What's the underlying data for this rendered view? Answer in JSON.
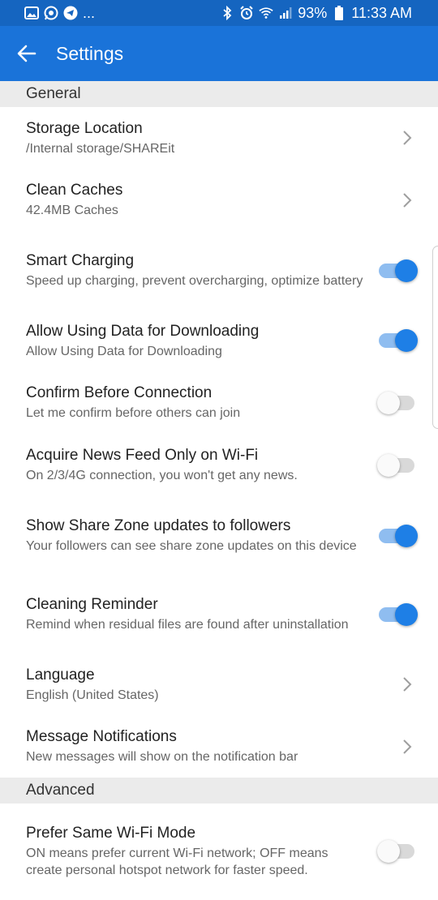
{
  "status_bar": {
    "left_icons": [
      "gallery-icon",
      "whatsapp-icon",
      "telegram-icon"
    ],
    "more": "...",
    "right_icons": [
      "bluetooth-icon",
      "alarm-icon",
      "wifi-icon",
      "signal-icon"
    ],
    "battery": "93%",
    "time": "11:33 AM"
  },
  "app_bar": {
    "title": "Settings",
    "back_icon": "arrow-left-icon",
    "background": "#1a73d9"
  },
  "sections": {
    "general": "General",
    "advanced": "Advanced"
  },
  "rows": [
    {
      "title": "Storage Location",
      "subtitle": "/Internal storage/SHAREit",
      "control": "chevron"
    },
    {
      "title": "Clean Caches",
      "subtitle": "42.4MB Caches",
      "control": "chevron"
    },
    {
      "title": "Smart Charging",
      "subtitle": "Speed up charging, prevent overcharging, optimize battery",
      "control": "toggle",
      "on": true
    },
    {
      "title": "Allow Using Data for Downloading",
      "subtitle": "Allow Using Data for Downloading",
      "control": "toggle",
      "on": true
    },
    {
      "title": "Confirm Before Connection",
      "subtitle": "Let me confirm before others can join",
      "control": "toggle",
      "on": false
    },
    {
      "title": "Acquire News Feed Only on Wi-Fi",
      "subtitle": "On 2/3/4G connection, you won't get any news.",
      "control": "toggle",
      "on": false
    },
    {
      "title": "Show Share Zone updates to followers",
      "subtitle": "Your followers can see share zone updates on this device",
      "control": "toggle",
      "on": true
    },
    {
      "title": "Cleaning Reminder",
      "subtitle": "Remind when residual files are found after uninstallation",
      "control": "toggle",
      "on": true
    },
    {
      "title": "Language",
      "subtitle": "English (United States)",
      "control": "chevron"
    },
    {
      "title": "Message Notifications",
      "subtitle": "New messages will show on the notification bar",
      "control": "chevron"
    },
    {
      "title": "Prefer Same Wi-Fi Mode",
      "subtitle": "ON means prefer current Wi-Fi network; OFF means create personal hotspot network for faster speed.",
      "control": "toggle",
      "on": false
    }
  ],
  "colors": {
    "status_bar": "#1565c0",
    "accent": "#1e7fe6",
    "section_bg": "#ebebeb"
  }
}
